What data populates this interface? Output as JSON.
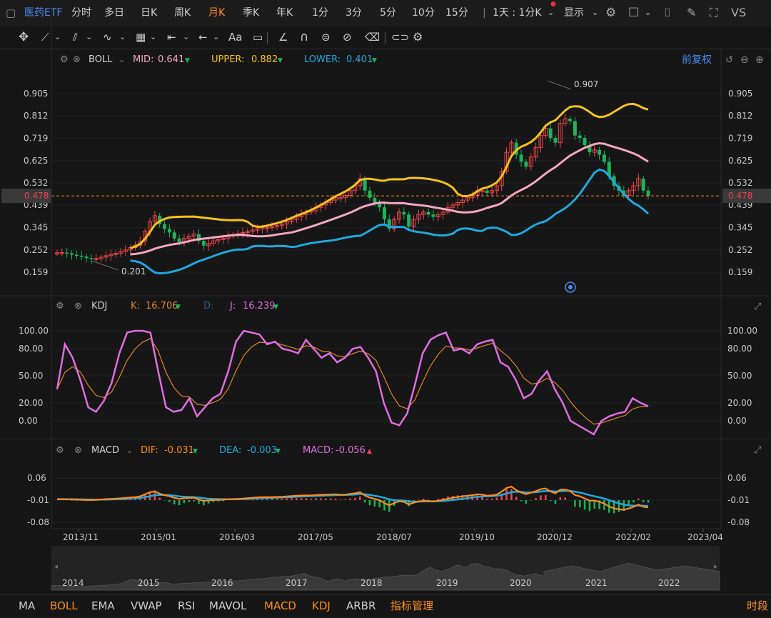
{
  "topbar": {
    "title": "医药ETF",
    "tabs": [
      "分时",
      "多日",
      "日K",
      "周K",
      "月K",
      "季K",
      "年K",
      "1分",
      "3分",
      "5分",
      "10分",
      "15分"
    ],
    "active_tab": "月K",
    "period_select": "1天 : 1分K",
    "display": "显示",
    "vs": "VS"
  },
  "toolbar2": {
    "aa": "Aa"
  },
  "boll": {
    "name": "BOLL",
    "mid_label": "MID:",
    "mid_value": "0.641",
    "upper_label": "UPPER:",
    "upper_value": "0.882",
    "lower_label": "LOWER:",
    "lower_value": "0.401",
    "fq": "前复权",
    "high_label": "0.907",
    "low_label": "0.201",
    "price_tag": "0.478",
    "yticks": [
      "0.905",
      "0.812",
      "0.719",
      "0.625",
      "0.532",
      "0.439",
      "0.345",
      "0.252",
      "0.159"
    ]
  },
  "kdj": {
    "name": "KDJ",
    "k_label": "K:",
    "k_value": "16.706",
    "d_label": "D:",
    "j_label": "J:",
    "j_value": "16.239",
    "yticks": [
      "100.00",
      "80.00",
      "50.00",
      "20.00",
      "0.00"
    ]
  },
  "macd": {
    "name": "MACD",
    "dif_label": "DIF:",
    "dif_value": "-0.031",
    "dea_label": "DEA:",
    "dea_value": "-0.003",
    "macd_label": "MACD:",
    "macd_value": "-0.056",
    "yticks": [
      "0.06",
      "-0.01",
      "-0.08"
    ]
  },
  "xaxis": [
    "2013/11",
    "2015/01",
    "2016/03",
    "2017/05",
    "2018/07",
    "2019/10",
    "2020/12",
    "2022/02",
    "2023/04"
  ],
  "navigator_years": [
    "2014",
    "2015",
    "2016",
    "2017",
    "2018",
    "2019",
    "2020",
    "2021",
    "2022"
  ],
  "bottombar": {
    "items": [
      "MA",
      "BOLL",
      "EMA",
      "VWAP",
      "RSI",
      "MAVOL",
      "MACD",
      "KDJ",
      "ARBR",
      "指标管理"
    ],
    "highlighted": [
      "BOLL",
      "MACD",
      "KDJ",
      "指标管理"
    ],
    "right": "时段"
  },
  "colors": {
    "up": "#f0454a",
    "down": "#1fb35a",
    "mid": "#f3a7c2",
    "upper": "#f4c21d",
    "lower": "#21a8df",
    "k": "#e0872b",
    "j": "#e06ee0",
    "dif": "#ff8c1a",
    "dea": "#21a8df",
    "accent": "#ff8c1a"
  },
  "chart_data": [
    {
      "type": "candlestick",
      "title": "BOLL",
      "y_range": [
        0.159,
        0.905
      ],
      "x_range": [
        "2013/11",
        "2023/04"
      ],
      "annotations": [
        {
          "text": "0.907",
          "meaning": "period high"
        },
        {
          "text": "0.201",
          "meaning": "period low"
        }
      ],
      "current_price": 0.478,
      "closes": [
        0.24,
        0.241,
        0.238,
        0.232,
        0.228,
        0.224,
        0.218,
        0.214,
        0.216,
        0.222,
        0.228,
        0.233,
        0.238,
        0.245,
        0.252,
        0.262,
        0.272,
        0.288,
        0.33,
        0.37,
        0.395,
        0.36,
        0.34,
        0.325,
        0.3,
        0.285,
        0.3,
        0.31,
        0.318,
        0.29,
        0.27,
        0.28,
        0.29,
        0.295,
        0.3,
        0.31,
        0.315,
        0.32,
        0.325,
        0.33,
        0.335,
        0.34,
        0.345,
        0.345,
        0.35,
        0.355,
        0.36,
        0.37,
        0.38,
        0.39,
        0.4,
        0.41,
        0.415,
        0.43,
        0.44,
        0.45,
        0.46,
        0.47,
        0.47,
        0.48,
        0.5,
        0.52,
        0.55,
        0.5,
        0.47,
        0.45,
        0.43,
        0.38,
        0.34,
        0.38,
        0.41,
        0.4,
        0.35,
        0.38,
        0.4,
        0.41,
        0.4,
        0.39,
        0.4,
        0.41,
        0.43,
        0.44,
        0.45,
        0.46,
        0.47,
        0.48,
        0.5,
        0.5,
        0.49,
        0.5,
        0.52,
        0.58,
        0.66,
        0.7,
        0.65,
        0.62,
        0.6,
        0.64,
        0.68,
        0.73,
        0.76,
        0.72,
        0.7,
        0.78,
        0.8,
        0.79,
        0.73,
        0.72,
        0.69,
        0.66,
        0.67,
        0.65,
        0.62,
        0.56,
        0.52,
        0.5,
        0.48,
        0.5,
        0.52,
        0.55,
        0.5,
        0.478
      ],
      "series": [
        {
          "name": "MID",
          "last": 0.641
        },
        {
          "name": "UPPER",
          "last": 0.882
        },
        {
          "name": "LOWER",
          "last": 0.401
        }
      ]
    },
    {
      "type": "line",
      "title": "KDJ",
      "y_range": [
        0,
        100
      ],
      "series": [
        {
          "name": "K",
          "last": 16.706
        },
        {
          "name": "J",
          "last": 16.239,
          "values": [
            35,
            85,
            70,
            45,
            15,
            10,
            22,
            42,
            75,
            98,
            100,
            100,
            98,
            55,
            15,
            10,
            12,
            25,
            5,
            15,
            25,
            30,
            55,
            88,
            100,
            98,
            96,
            85,
            88,
            80,
            78,
            75,
            90,
            80,
            70,
            75,
            65,
            70,
            80,
            82,
            70,
            55,
            20,
            -2,
            -5,
            8,
            40,
            75,
            90,
            95,
            98,
            78,
            80,
            75,
            85,
            88,
            90,
            65,
            60,
            45,
            25,
            30,
            45,
            55,
            35,
            20,
            0,
            -5,
            -10,
            -15,
            0,
            5,
            8,
            10,
            25,
            20,
            16.239
          ]
        },
        {
          "name": "D"
        }
      ]
    },
    {
      "type": "line",
      "title": "MACD",
      "y_range": [
        -0.08,
        0.06
      ],
      "series": [
        {
          "name": "DIF",
          "last": -0.031
        },
        {
          "name": "DEA",
          "last": -0.003
        },
        {
          "name": "MACD",
          "last": -0.056
        }
      ]
    }
  ]
}
